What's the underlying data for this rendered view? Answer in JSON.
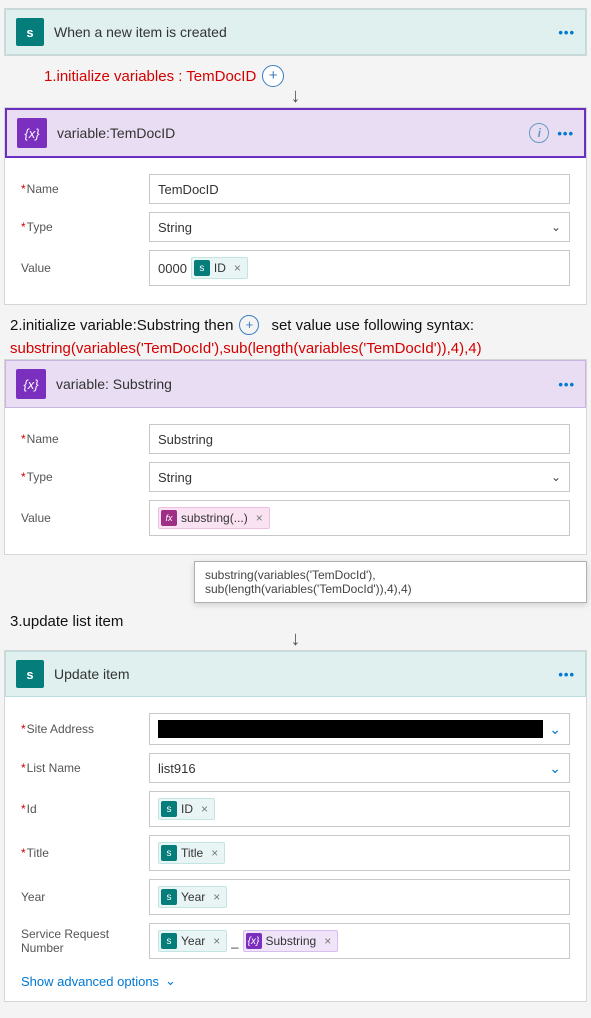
{
  "trigger": {
    "title": "When a new item is created"
  },
  "annotation1": "1.initialize variables : TemDocID",
  "var_temdocid": {
    "header": "variable:TemDocID",
    "name_label": "Name",
    "name_value": "TemDocID",
    "type_label": "Type",
    "type_value": "String",
    "value_label": "Value",
    "value_prefix": "0000",
    "token_id": "ID"
  },
  "annotation2a": "2.initialize variable:Substring then",
  "annotation2b": "set value use following syntax:",
  "annotation2_expr": "substring(variables('TemDocId'),sub(length(variables('TemDocId')),4),4)",
  "var_substring": {
    "header": "variable: Substring",
    "name_label": "Name",
    "name_value": "Substring",
    "type_label": "Type",
    "type_value": "String",
    "value_label": "Value",
    "token_fx": "substring(...)"
  },
  "tooltip_expr": "substring(variables('TemDocId'), sub(length(variables('TemDocId')),4),4)",
  "annotation3": "3.update list item",
  "update_item": {
    "header": "Update item",
    "site_label": "Site Address",
    "list_label": "List Name",
    "list_value": "list916",
    "id_label": "Id",
    "id_token": "ID",
    "title_label": "Title",
    "title_token": "Title",
    "year_label": "Year",
    "year_token": "Year",
    "srn_label": "Service Request Number",
    "srn_token1": "Year",
    "srn_sep": "_",
    "srn_token2": "Substring"
  },
  "advanced": "Show advanced options",
  "glyph": {
    "sp": "s",
    "var": "{x}",
    "fx": "fx",
    "id": "s",
    "x": "×"
  }
}
